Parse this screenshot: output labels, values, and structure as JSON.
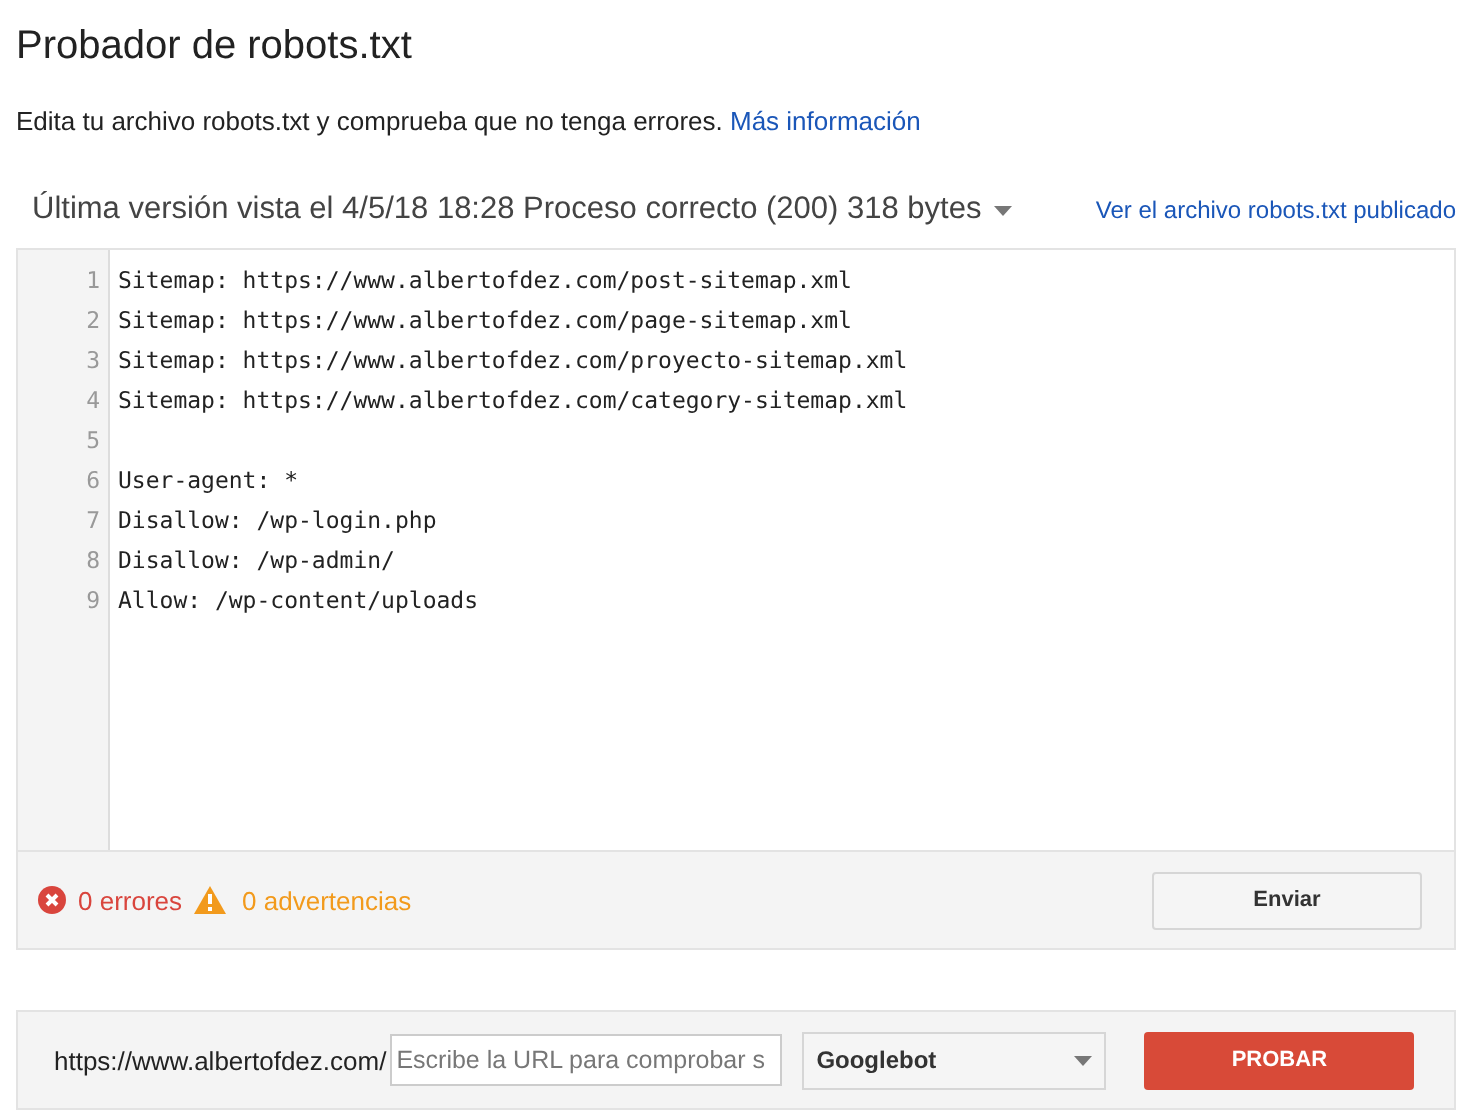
{
  "title": "Probador de robots.txt",
  "description": {
    "text": "Edita tu archivo robots.txt y comprueba que no tenga errores.",
    "link": "Más información"
  },
  "version": {
    "label": "Última versión vista el 4/5/18 18:28 Proceso correcto (200) 318 bytes",
    "link": "Ver el archivo robots.txt publicado"
  },
  "editor": {
    "lines": [
      {
        "number": "1",
        "text": "Sitemap: https://www.albertofdez.com/post-sitemap.xml"
      },
      {
        "number": "2",
        "text": "Sitemap: https://www.albertofdez.com/page-sitemap.xml"
      },
      {
        "number": "3",
        "text": "Sitemap: https://www.albertofdez.com/proyecto-sitemap.xml"
      },
      {
        "number": "4",
        "text": "Sitemap: https://www.albertofdez.com/category-sitemap.xml"
      },
      {
        "number": "5"
      },
      {
        "number": "6",
        "text": "User-agent: *"
      },
      {
        "number": "7",
        "text": "Disallow: /wp-login.php"
      },
      {
        "number": "8",
        "text": "Disallow: /wp-admin/"
      },
      {
        "number": "9",
        "text": "Allow: /wp-content/uploads"
      }
    ]
  },
  "status": {
    "errors": "0 errores",
    "warnings": "0 advertencias",
    "submit": "Enviar"
  },
  "test": {
    "prefix": "https://www.albertofdez.com/",
    "placeholder": "Escribe la URL para comprobar s",
    "agent": "Googlebot",
    "button": "PROBAR"
  }
}
